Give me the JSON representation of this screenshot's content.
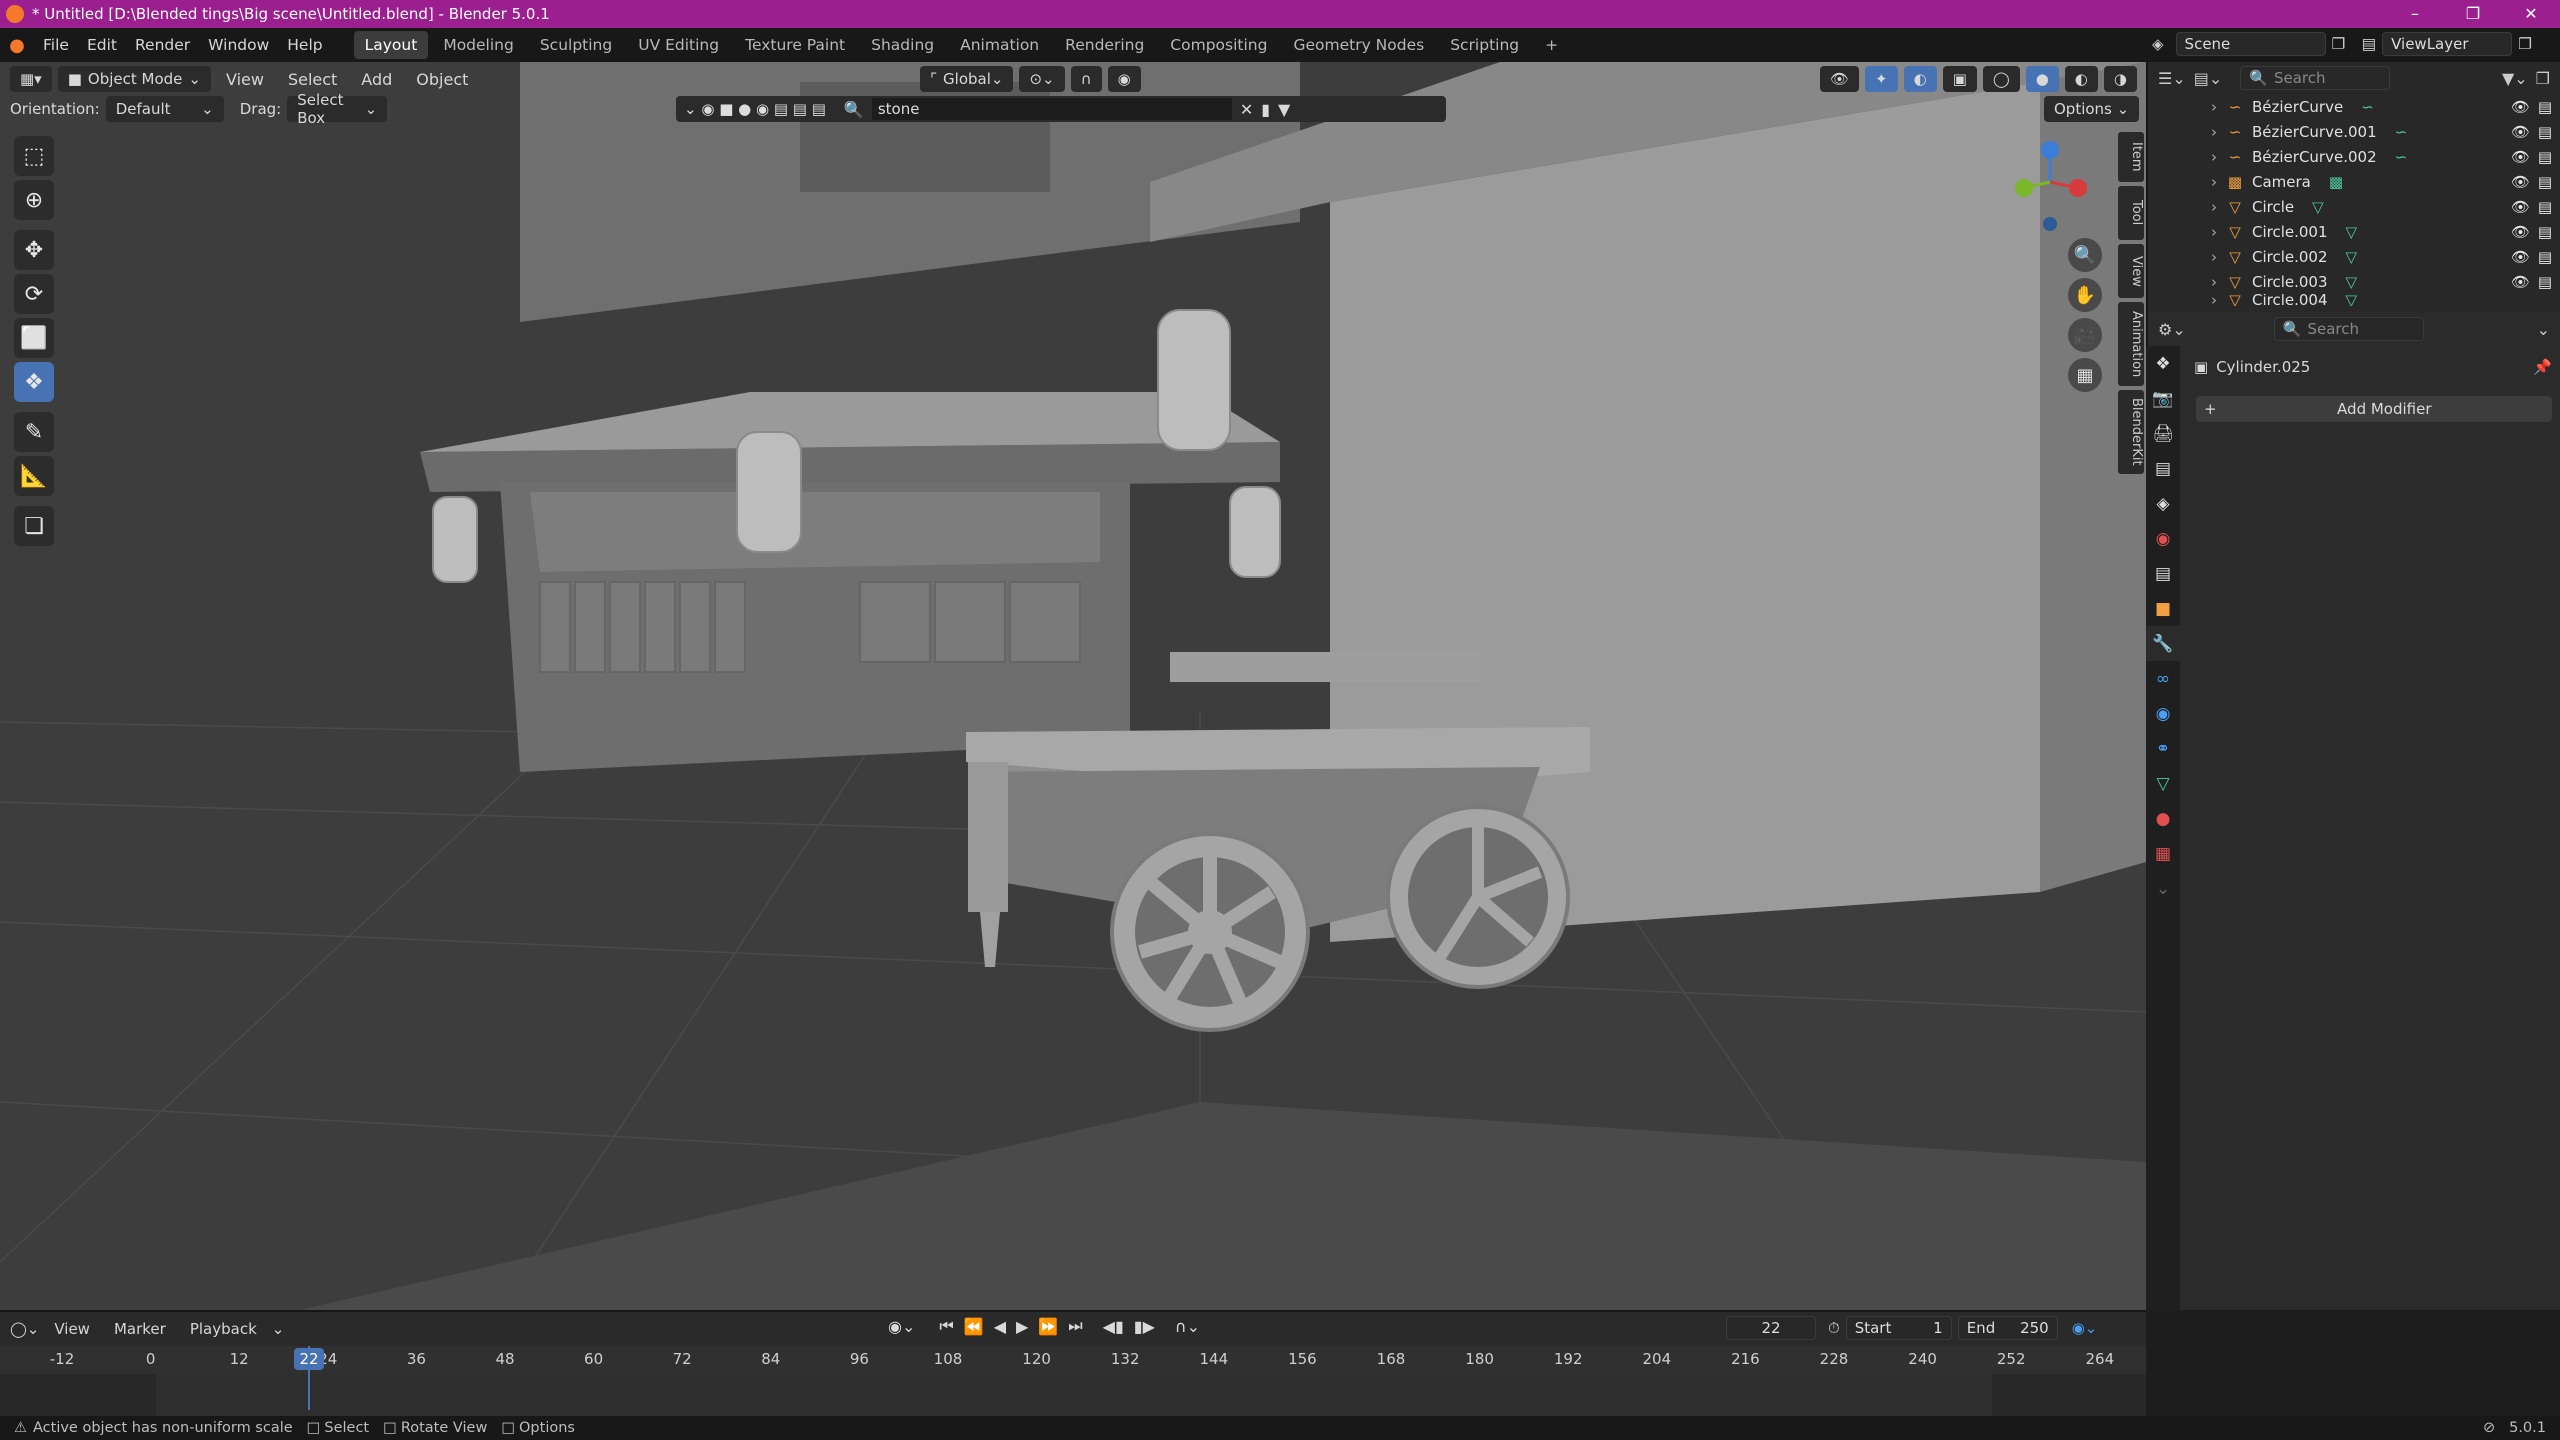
{
  "title": "* Untitled [D:\\Blended tings\\Big scene\\Untitled.blend] - Blender 5.0.1",
  "menu": [
    "File",
    "Edit",
    "Render",
    "Window",
    "Help"
  ],
  "workspaces": [
    "Layout",
    "Modeling",
    "Sculpting",
    "UV Editing",
    "Texture Paint",
    "Shading",
    "Animation",
    "Rendering",
    "Compositing",
    "Geometry Nodes",
    "Scripting"
  ],
  "active_workspace": "Layout",
  "scene_name": "Scene",
  "view_layer": "ViewLayer",
  "viewport": {
    "mode": "Object Mode",
    "header_menus": [
      "View",
      "Select",
      "Add",
      "Object"
    ],
    "transform_orientation": "Global",
    "orientation_label": "Orientation:",
    "orientation_value": "Default",
    "drag_label": "Drag:",
    "drag_value": "Select Box",
    "filter_search": "stone",
    "options_label": "Options",
    "side_tabs": [
      "Item",
      "Tool",
      "View",
      "Animation",
      "BlenderKit"
    ]
  },
  "outliner": {
    "search_placeholder": "Search",
    "items": [
      {
        "name": "BézierCurve",
        "icon": "curve-icon",
        "sub": "curve-data-icon"
      },
      {
        "name": "BézierCurve.001",
        "icon": "curve-icon",
        "sub": "curve-data-icon"
      },
      {
        "name": "BézierCurve.002",
        "icon": "curve-icon",
        "sub": "curve-data-icon"
      },
      {
        "name": "Camera",
        "icon": "camera-icon",
        "sub": "camera-data-icon"
      },
      {
        "name": "Circle",
        "icon": "mesh-icon",
        "sub": "mesh-data-icon"
      },
      {
        "name": "Circle.001",
        "icon": "mesh-icon",
        "sub": "mesh-data-icon"
      },
      {
        "name": "Circle.002",
        "icon": "mesh-icon",
        "sub": "mesh-data-icon"
      },
      {
        "name": "Circle.003",
        "icon": "mesh-icon",
        "sub": "mesh-data-icon"
      },
      {
        "name": "Circle.004",
        "icon": "mesh-icon",
        "sub": "mesh-data-icon"
      }
    ]
  },
  "properties": {
    "search_placeholder": "Search",
    "object_name": "Cylinder.025",
    "add_modifier": "Add Modifier"
  },
  "timeline": {
    "menus": [
      "View",
      "Marker",
      "Playback"
    ],
    "current_frame": "22",
    "start_label": "Start",
    "start_value": "1",
    "end_label": "End",
    "end_value": "250",
    "ruler_ticks": [
      "-12",
      "0",
      "12",
      "24",
      "36",
      "48",
      "60",
      "72",
      "84",
      "96",
      "108",
      "120",
      "132",
      "144",
      "156",
      "168",
      "180",
      "192",
      "204",
      "216",
      "228",
      "240",
      "252",
      "264"
    ]
  },
  "statusbar": {
    "message": "Active object has non-uniform scale",
    "hints": [
      "Select",
      "Rotate View",
      "Options"
    ],
    "version": "5.0.1"
  }
}
